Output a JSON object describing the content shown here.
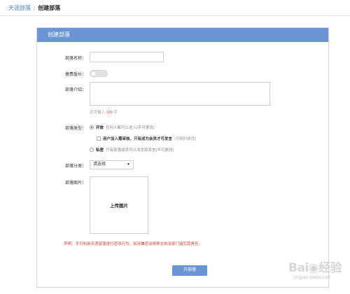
{
  "breadcrumb": {
    "home": "天涯部落",
    "separator": "/",
    "current": "创建部落"
  },
  "panel": {
    "title": "创建部落"
  },
  "form": {
    "name_label": "部落名称：",
    "fee_label": "缴费盾长：",
    "intro_label": "部落介绍：",
    "intro_hint_prefix": "还可输入",
    "intro_hint_count": "100",
    "intro_hint_suffix": "字",
    "type_label": "部落类型：",
    "type_options": [
      {
        "label": "开放",
        "desc": "任何人都可以进入(不可更改)",
        "selected": true
      },
      {
        "label": "私密",
        "desc": "只有部落成员可以浏览和发言(不可更改)",
        "selected": false
      }
    ],
    "sub_option_text": "用户加入需审核，只有成为会员才可发言",
    "sub_option_note": "(可随时更改)",
    "category_label": "部落分类：",
    "category_value": "请选择",
    "category_arrow": "▼",
    "image_label": "部落图片：",
    "upload_text": "上传图片",
    "declaration": "声明：不可利用天涯部落进行违法行为，如涉嫌违法将移交执法部门追究其责任。",
    "submit_label": "开部落"
  },
  "watermark": {
    "main": "Bai◉经验",
    "sub": "jingyan.baidu.com"
  },
  "colors": {
    "accent": "#6b94d4",
    "warning": "#d93b2e"
  }
}
